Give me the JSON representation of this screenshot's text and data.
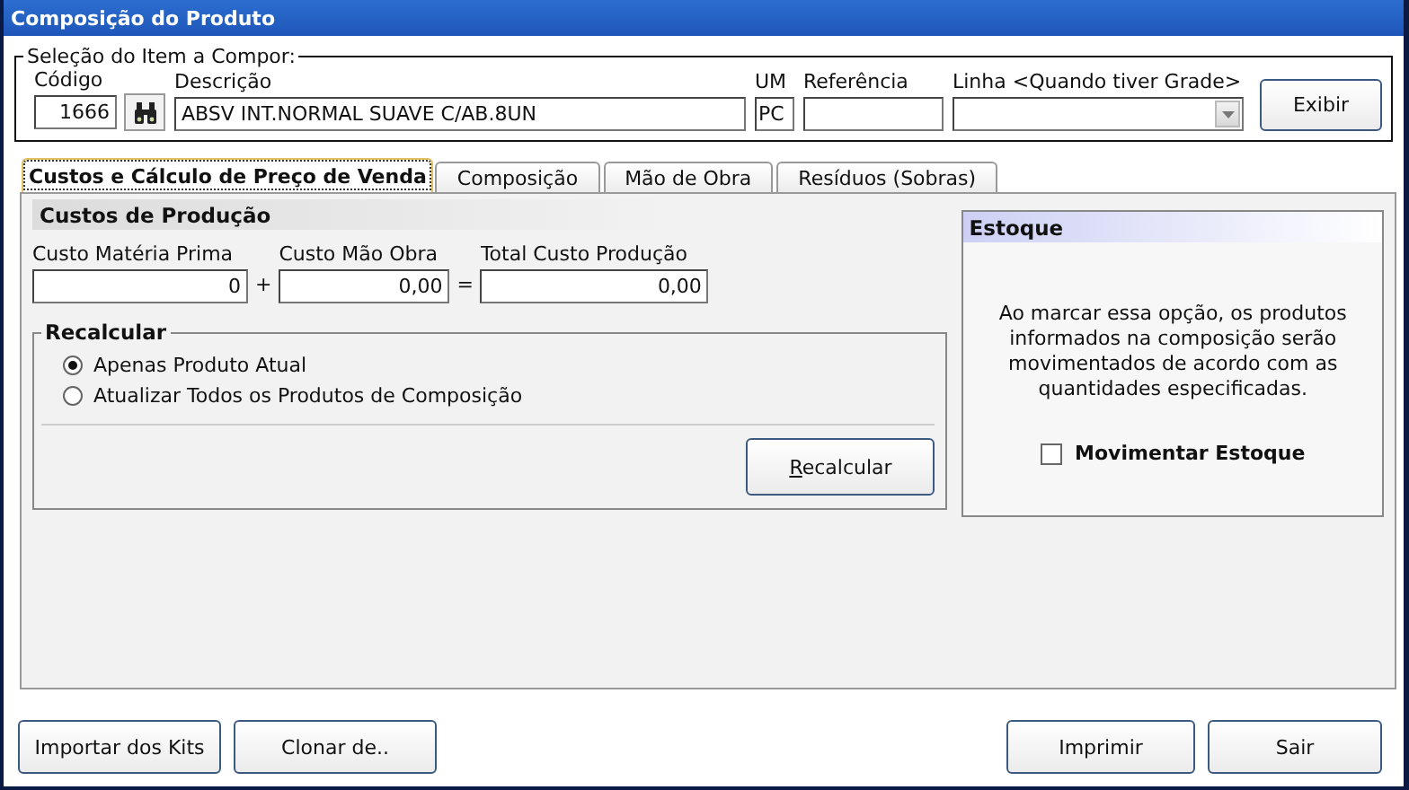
{
  "window": {
    "title": "Composição do Produto"
  },
  "item_selection": {
    "legend": "Seleção do Item a Compor:",
    "fields": [
      {
        "label": "Código",
        "value": "1666",
        "kind": "code"
      },
      {
        "label": "Descrição",
        "value": "ABSV INT.NORMAL SUAVE C/AB.8UN",
        "kind": "text"
      },
      {
        "label": "UM",
        "value": "PC",
        "kind": "unit"
      },
      {
        "label": "Referência",
        "kind": "ref"
      },
      {
        "label": "Linha <Quando tiver Grade>",
        "kind": "combo"
      }
    ],
    "button": "Exibir"
  },
  "tabs": [
    {
      "label": "Custos e Cálculo de Preço de Venda",
      "selected": true
    },
    {
      "label": "Composição",
      "selected": false
    },
    {
      "label": "Mão de Obra",
      "selected": false
    },
    {
      "label": "Resíduos (Sobras)",
      "selected": false
    }
  ],
  "production_costs": {
    "title": "Custos de Produção",
    "fields": [
      {
        "label": "Custo Matéria Prima",
        "value": "0",
        "operator": "+"
      },
      {
        "label": "Custo Mão Obra",
        "value": "0,00",
        "operator": "="
      },
      {
        "label": "Total Custo Produção",
        "value": "0,00"
      }
    ]
  },
  "recalculate": {
    "legend": "Recalcular",
    "options": [
      {
        "label": "Apenas Produto Atual",
        "selected": true
      },
      {
        "label": "Atualizar Todos os Produtos de Composição",
        "selected": false
      }
    ],
    "button": "Recalcular"
  },
  "stock": {
    "title": "Estoque",
    "note": "Ao marcar essa opção, os produtos informados na composição serão movimentados de acordo com as quantidades especificadas.",
    "checkbox": {
      "label": "Movimentar Estoque",
      "checked": false
    }
  },
  "footer_buttons": {
    "left": [
      "Importar dos Kits",
      "Clonar de.."
    ],
    "right": [
      "Imprimir",
      "Sair"
    ]
  }
}
